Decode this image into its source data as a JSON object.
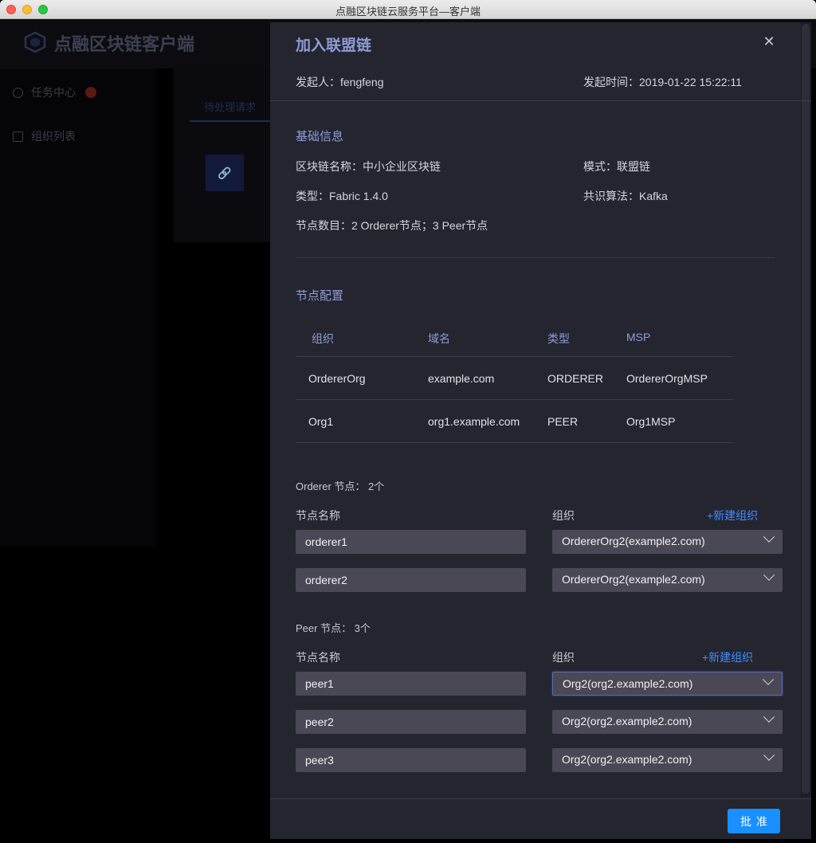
{
  "window": {
    "title": "点融区块链云服务平台—客户端"
  },
  "app": {
    "name": "点融区块链客户端"
  },
  "sidebar": {
    "items": [
      {
        "label": "任务中心"
      },
      {
        "label": "组织列表"
      }
    ]
  },
  "content": {
    "tab": "待处理请求"
  },
  "drawer": {
    "title": "加入联盟链",
    "initiator": "发起人：fengfeng",
    "time": "发起时间：2019-01-22 15:22:11",
    "basic": {
      "title": "基础信息",
      "chain_name": "区块链名称：中小企业区块链",
      "mode": "模式：联盟链",
      "type": "类型：Fabric 1.4.0",
      "consensus": "共识算法：Kafka",
      "nodes": "节点数目：2 Orderer节点；3 Peer节点"
    },
    "node_config": {
      "title": "节点配置",
      "columns": [
        "组织",
        "域名",
        "类型",
        "MSP"
      ],
      "rows": [
        [
          "OrdererOrg",
          "example.com",
          "ORDERER",
          "OrdererOrgMSP"
        ],
        [
          "Org1",
          "org1.example.com",
          "PEER",
          "Org1MSP"
        ]
      ]
    },
    "orderer": {
      "count_label": "Orderer 节点：  2个",
      "name_label": "节点名称",
      "org_label": "组织",
      "add_org": "+新建组织",
      "nodes": [
        {
          "name": "orderer1",
          "org": "OrdererOrg2(example2.com)"
        },
        {
          "name": "orderer2",
          "org": "OrdererOrg2(example2.com)"
        }
      ]
    },
    "peer": {
      "count_label": "Peer 节点：  3个",
      "name_label": "节点名称",
      "org_label": "组织",
      "add_org": "+新建组织",
      "nodes": [
        {
          "name": "peer1",
          "org": "Org2(org2.example2.com)"
        },
        {
          "name": "peer2",
          "org": "Org2(org2.example2.com)"
        },
        {
          "name": "peer3",
          "org": "Org2(org2.example2.com)"
        }
      ]
    },
    "approve": "批准",
    "close_icon": "close-icon"
  },
  "colors": {
    "accent": "#1890ff",
    "title": "#8e9bd6",
    "panel": "#25252f",
    "input": "#4a4854"
  }
}
